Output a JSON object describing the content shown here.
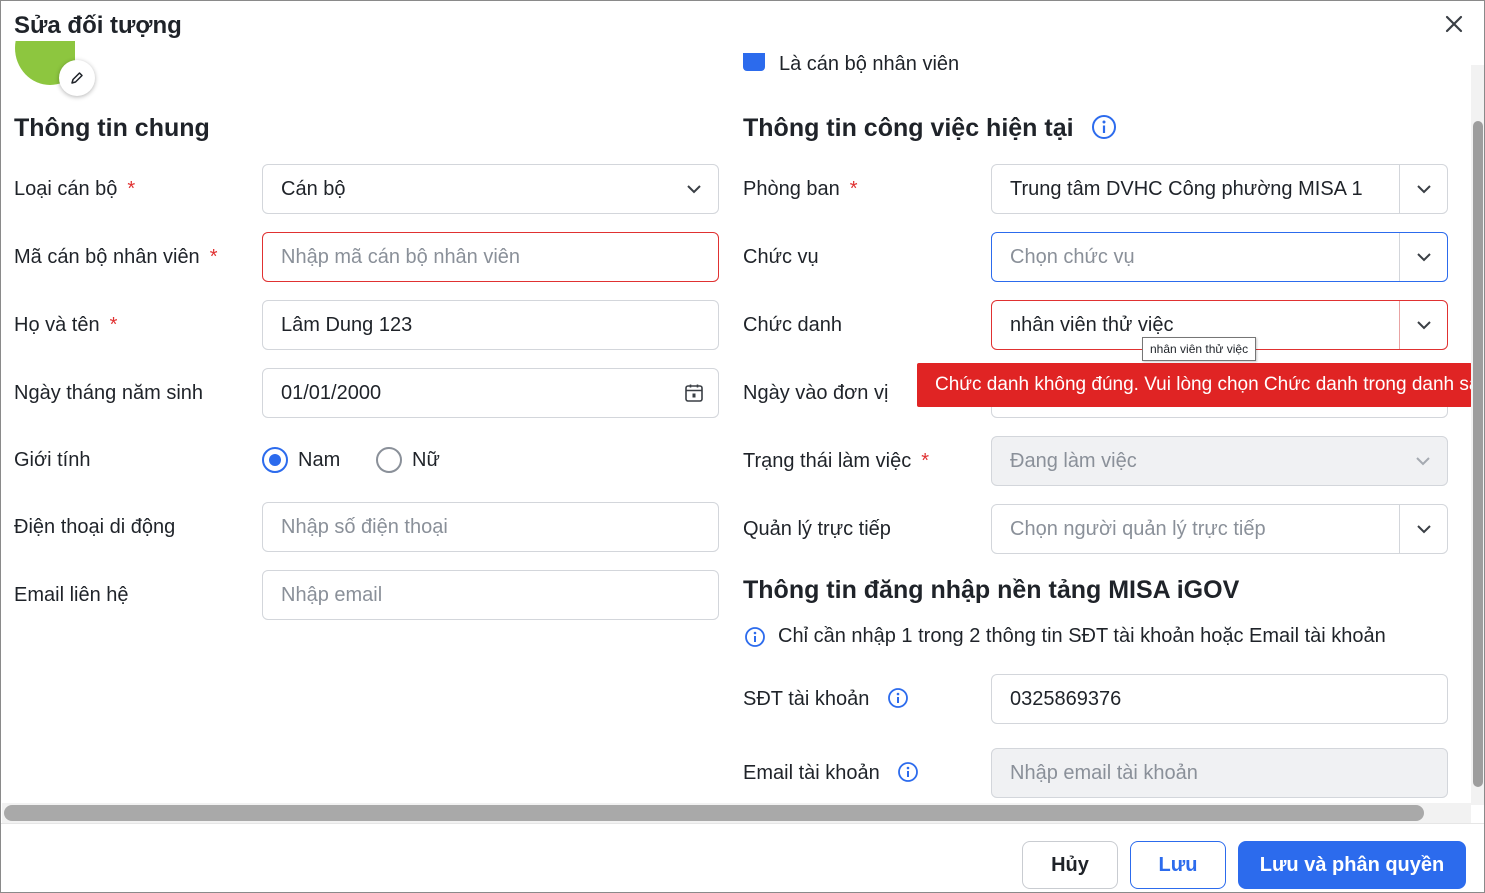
{
  "dialog": {
    "title": "Sửa đối tượng"
  },
  "top_checkbox": {
    "label": "Là cán bộ nhân viên",
    "checked": true
  },
  "general": {
    "heading": "Thông tin chung",
    "staff_type": {
      "label": "Loại cán bộ",
      "value": "Cán bộ"
    },
    "staff_code": {
      "label": "Mã cán bộ nhân viên",
      "placeholder": "Nhập mã cán bộ nhân viên"
    },
    "full_name": {
      "label": "Họ và tên",
      "value": "Lâm Dung 123"
    },
    "birth_date": {
      "label": "Ngày tháng năm sinh",
      "value": "01/01/2000"
    },
    "gender": {
      "label": "Giới tính",
      "options": [
        "Nam",
        "Nữ"
      ],
      "selected": "Nam"
    },
    "mobile": {
      "label": "Điện thoại di động",
      "placeholder": "Nhập số điện thoại"
    },
    "email": {
      "label": "Email liên hệ",
      "placeholder": "Nhập email"
    }
  },
  "job": {
    "heading": "Thông tin công việc hiện tại",
    "department": {
      "label": "Phòng ban",
      "value": "Trung tâm DVHC Công phường MISA 1"
    },
    "position": {
      "label": "Chức vụ",
      "placeholder": "Chọn chức vụ"
    },
    "title": {
      "label": "Chức danh",
      "value": "nhân viên thử việc",
      "tooltip": "nhân viên thử việc",
      "error": "Chức danh không đúng. Vui lòng chọn Chức danh trong danh sách"
    },
    "join_date": {
      "label": "Ngày vào đơn vị"
    },
    "work_status": {
      "label": "Trạng thái làm việc",
      "value": "Đang làm việc"
    },
    "manager": {
      "label": "Quản lý trực tiếp",
      "placeholder": "Chọn người quản lý trực tiếp"
    }
  },
  "login": {
    "heading": "Thông tin đăng nhập nền tảng MISA iGOV",
    "note": "Chỉ cần nhập 1 trong 2 thông tin SĐT tài khoản hoặc Email tài khoản",
    "phone": {
      "label": "SĐT tài khoản",
      "value": "0325869376"
    },
    "email": {
      "label": "Email tài khoản",
      "placeholder": "Nhập email tài khoản"
    }
  },
  "footer": {
    "cancel": "Hủy",
    "save": "Lưu",
    "save_permissions": "Lưu và phân quyền"
  },
  "required_mark": "*",
  "colors": {
    "primary": "#2c6bed",
    "error": "#e02424",
    "avatar": "#8dc63f"
  },
  "icons": [
    "close-icon",
    "pencil-icon",
    "check-icon",
    "info-icon",
    "chevron-down-icon",
    "calendar-icon"
  ]
}
